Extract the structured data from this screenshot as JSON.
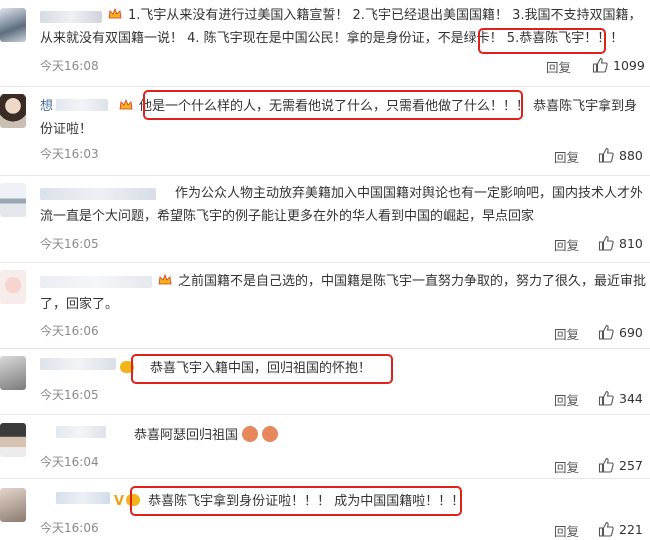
{
  "comments": [
    {
      "text": "1.飞宇从来没有进行过美国入籍宣誓！ 2.飞宇已经退出美国国籍！ 3.我国不支持双国籍，从来就没有双国籍一说！ 4. 陈飞宇现在是中国公民！拿的是身份证，不是绿卡！ 5.恭喜陈飞宇！！！",
      "time": "今天16:08",
      "reply": "回复",
      "likes": "1099"
    },
    {
      "name_fragment": "想",
      "text": "他是一个什么样的人，无需看他说了什么，只需看他做了什么！！！ 恭喜陈飞宇拿到身份证啦！",
      "time": "今天16:03",
      "reply": "回复",
      "likes": "880"
    },
    {
      "text": "作为公众人物主动放弃美籍加入中国国籍对舆论也有一定影响吧，国内技术人才外流一直是个大问题，希望陈飞宇的例子能让更多在外的华人看到中国的崛起，早点回家",
      "time": "今天16:05",
      "reply": "回复",
      "likes": "810"
    },
    {
      "text": "之前国籍不是自己选的，中国籍是陈飞宇一直努力争取的，努力了很久，最近审批了，回家了。",
      "time": "今天16:06",
      "reply": "回复",
      "likes": "690"
    },
    {
      "text": "恭喜飞宇入籍中国，回归祖国的怀抱！",
      "time": "今天16:05",
      "reply": "回复",
      "likes": "344"
    },
    {
      "text": "恭喜阿瑟回归祖国",
      "time": "今天16:04",
      "reply": "回复",
      "likes": "257"
    },
    {
      "text": "恭喜陈飞宇拿到身份证啦！！！ 成为中国国籍啦！！！",
      "time": "今天16:06",
      "reply": "回复",
      "likes": "221"
    }
  ],
  "colors": {
    "highlight": "#e0211b",
    "timestamp": "#8a8a8a",
    "text": "#333333"
  }
}
